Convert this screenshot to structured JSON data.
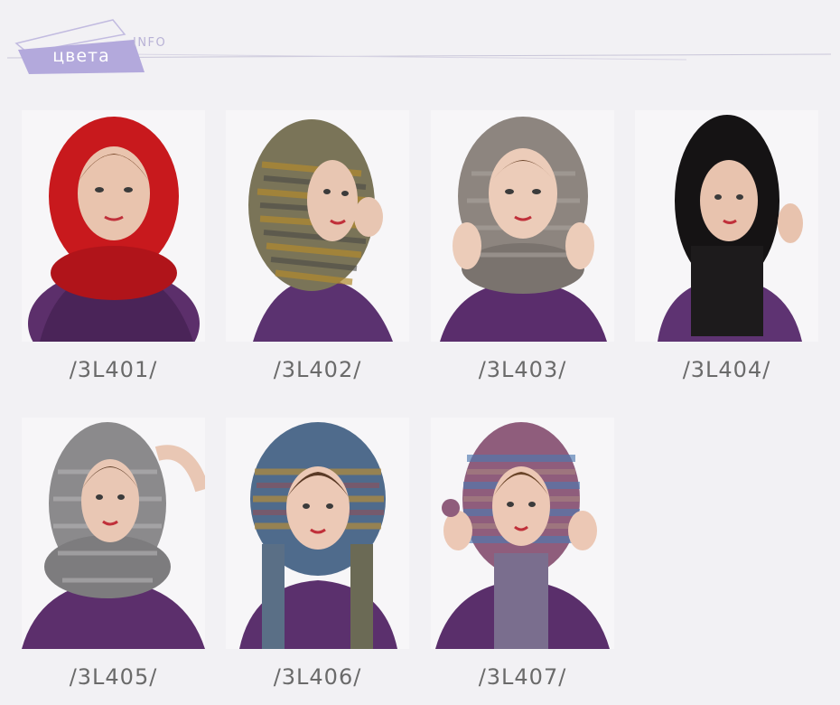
{
  "header": {
    "title": "цвета",
    "subtitle": "INFO",
    "accent_color": "#b3a9dc"
  },
  "products": [
    {
      "code": "/3L401/",
      "hood_color": "#c8191d",
      "image": "woman-in-red-fur-hood"
    },
    {
      "code": "/3L402/",
      "hood_color": "#7a7458",
      "image": "woman-in-olive-striped-fur-hood"
    },
    {
      "code": "/3L403/",
      "hood_color": "#8d857f",
      "image": "woman-in-grey-fur-hood"
    },
    {
      "code": "/3L404/",
      "hood_color": "#151314",
      "image": "woman-in-black-fur-hood"
    },
    {
      "code": "/3L405/",
      "hood_color": "#8b8a8c",
      "image": "woman-in-grey-chinchilla-fur-hood"
    },
    {
      "code": "/3L406/",
      "hood_color": "#4f6b8c",
      "image": "woman-in-multicolor-fur-hood"
    },
    {
      "code": "/3L407/",
      "hood_color": "#8f5d7c",
      "image": "woman-in-pink-blue-fur-hood"
    }
  ]
}
